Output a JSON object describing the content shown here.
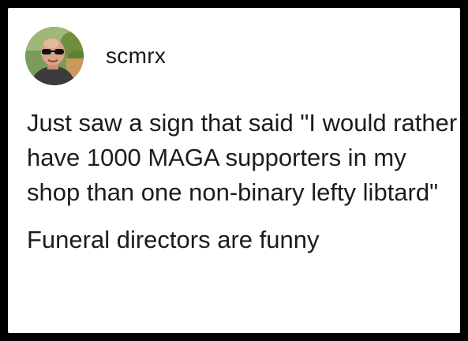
{
  "post": {
    "author": {
      "username": "scmrx",
      "avatar_icon": "profile-photo-avatar"
    },
    "paragraphs": [
      "Just saw a sign that said \"I would rather have 1000 MAGA supporters in my shop than one non-binary lefty libtard\"",
      "Funeral directors are funny"
    ]
  }
}
